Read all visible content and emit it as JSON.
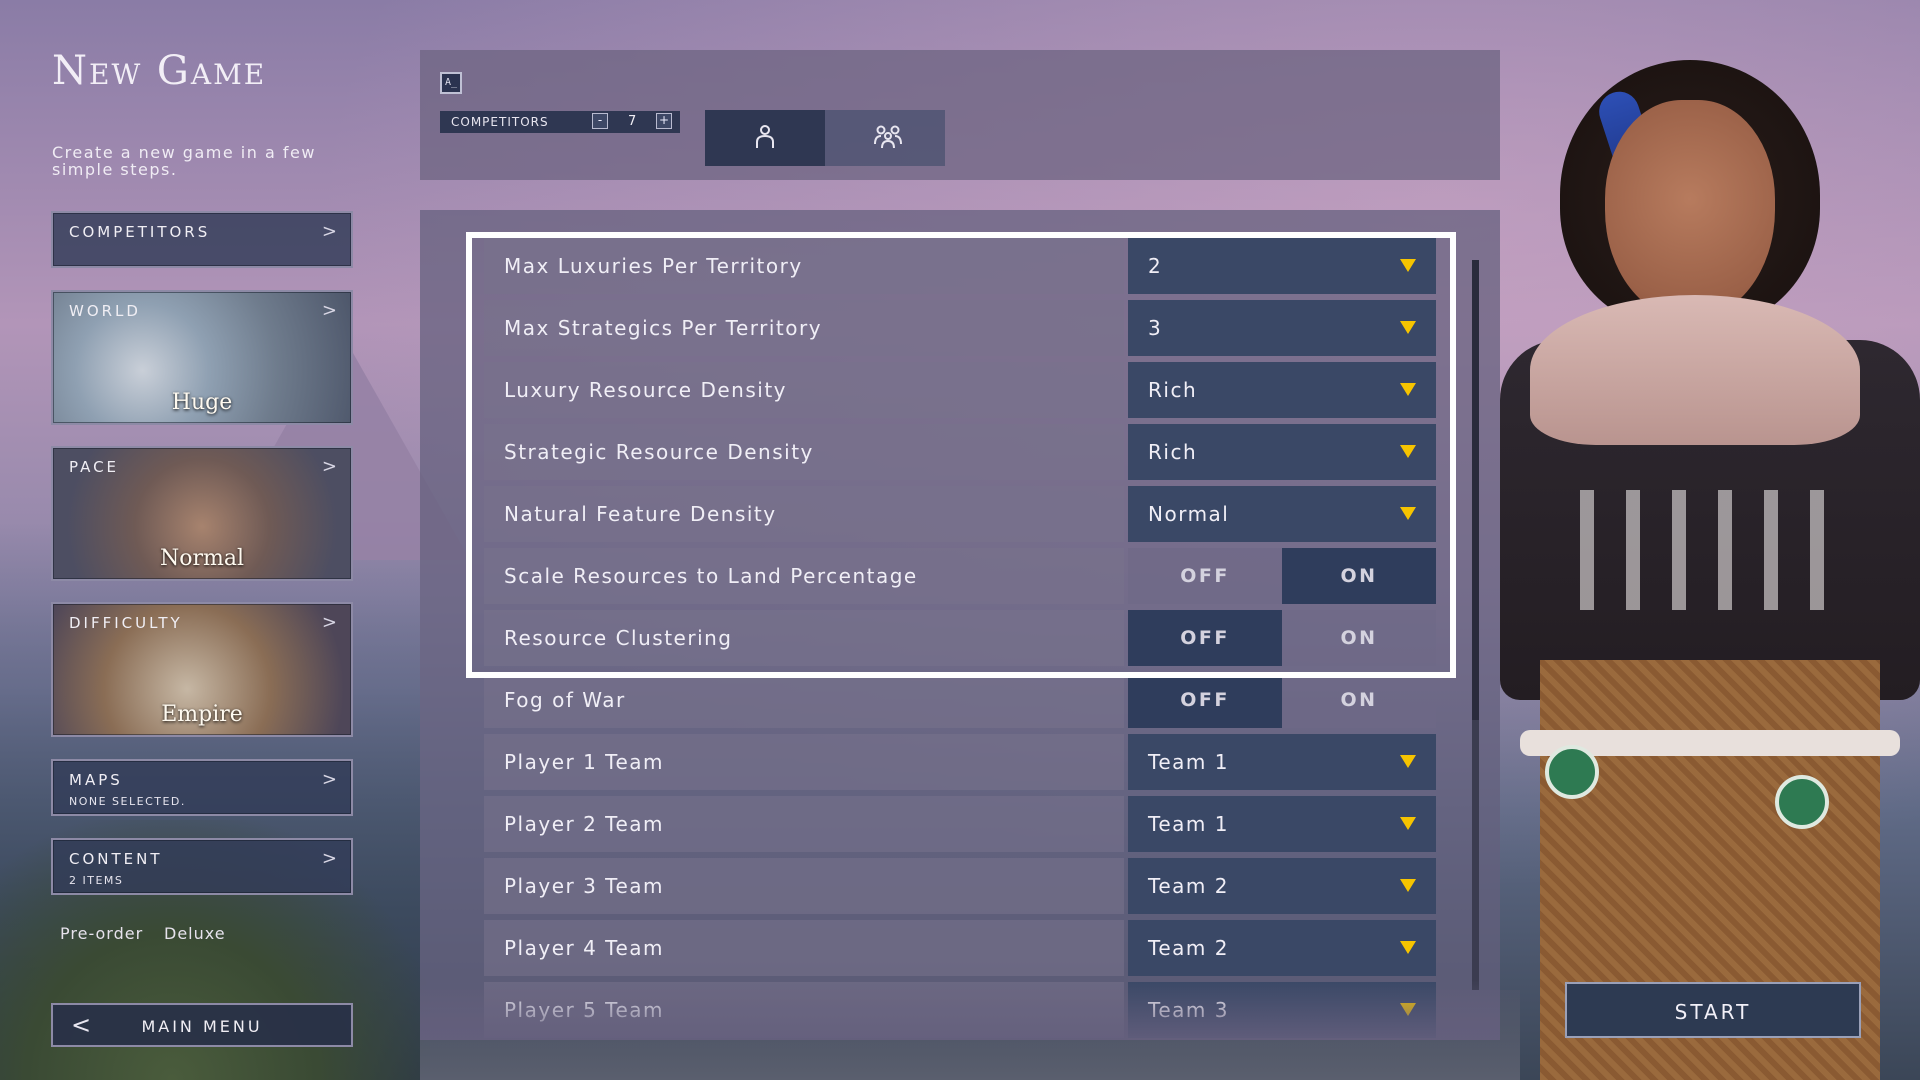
{
  "left": {
    "title": "New Game",
    "subtitle": "Create a new game in a few simple steps.",
    "cards": {
      "competitors": {
        "label": "COMPETITORS"
      },
      "world": {
        "label": "WORLD",
        "value": "Huge"
      },
      "pace": {
        "label": "PACE",
        "value": "Normal"
      },
      "difficulty": {
        "label": "DIFFICULTY",
        "value": "Empire"
      },
      "maps": {
        "label": "MAPS",
        "sub": "NONE SELECTED."
      },
      "content": {
        "label": "CONTENT",
        "sub": "2 ITEMS"
      }
    },
    "editions": [
      "Pre-order",
      "Deluxe"
    ],
    "main_menu_label": "MAIN MENU"
  },
  "top": {
    "console_icon": "A_",
    "competitors_label": "COMPETITORS",
    "competitors_count": "7",
    "minus": "-",
    "plus": "+",
    "tabs": [
      {
        "icon": "single-player-icon",
        "active": true
      },
      {
        "icon": "multiplayer-icon",
        "active": false
      }
    ]
  },
  "settings": [
    {
      "label": "Max Luxuries Per Territory",
      "type": "dropdown",
      "value": "2"
    },
    {
      "label": "Max Strategics Per Territory",
      "type": "dropdown",
      "value": "3"
    },
    {
      "label": "Luxury Resource Density",
      "type": "dropdown",
      "value": "Rich"
    },
    {
      "label": "Strategic Resource Density",
      "type": "dropdown",
      "value": "Rich"
    },
    {
      "label": "Natural Feature Density",
      "type": "dropdown",
      "value": "Normal"
    },
    {
      "label": "Scale Resources to Land Percentage",
      "type": "toggle",
      "off": "OFF",
      "on": "ON",
      "selected": "ON"
    },
    {
      "label": "Resource Clustering",
      "type": "toggle",
      "off": "OFF",
      "on": "ON",
      "selected": "OFF"
    },
    {
      "label": "Fog of War",
      "type": "toggle",
      "off": "OFF",
      "on": "ON",
      "selected": "OFF"
    },
    {
      "label": "Player 1 Team",
      "type": "dropdown",
      "value": "Team 1"
    },
    {
      "label": "Player 2 Team",
      "type": "dropdown",
      "value": "Team 1"
    },
    {
      "label": "Player 3 Team",
      "type": "dropdown",
      "value": "Team 2"
    },
    {
      "label": "Player 4 Team",
      "type": "dropdown",
      "value": "Team 2"
    },
    {
      "label": "Player 5 Team",
      "type": "dropdown",
      "value": "Team 3"
    }
  ],
  "start_label": "START",
  "colors": {
    "accent": "#f6c400",
    "panel": "#3a4866",
    "highlight": "#ffffff"
  }
}
